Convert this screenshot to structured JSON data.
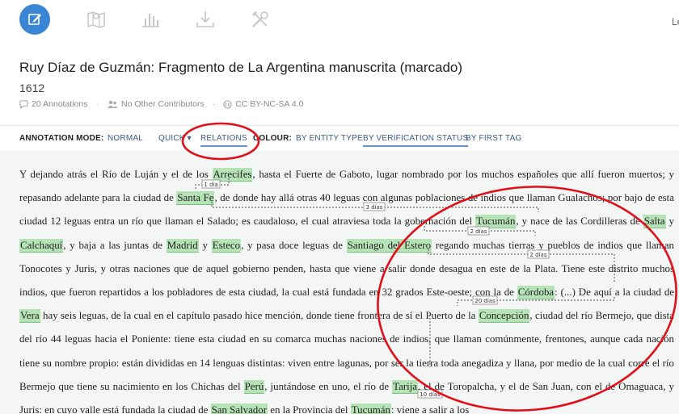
{
  "header": {
    "title": "Ruy Díaz de Guzmán: Fragmento de La Argentina manuscrita (marcado)",
    "year": "1612",
    "annotations": "20 Annotations",
    "contributors": "No Other Contributors",
    "license": "CC BY-NC-SA 4.0",
    "edge_text": "Le"
  },
  "toolbar": {
    "icons": [
      "edit-icon",
      "map-icon",
      "bar-chart-icon",
      "download-icon",
      "tools-icon"
    ],
    "accent": "#3a86d4"
  },
  "annotation_bar": {
    "mode_label": "ANNOTATION MODE:",
    "normal": "NORMAL",
    "quick": "QUICK",
    "relations": "RELATIONS",
    "colour_label": "COLOUR:",
    "by_entity_type": "BY ENTITY TYPE",
    "by_verification_status": "BY VERIFICATION STATUS",
    "by_first_tag": "BY FIRST TAG"
  },
  "relation_labels": [
    "1 día",
    "3 días",
    "2 días",
    "2 días",
    "20 días",
    "10 días"
  ],
  "colors": {
    "entity_highlight": "#b6e3b6",
    "markup_circle": "#e0101a",
    "link": "#3b5b8c"
  },
  "text": [
    {
      "t": "Y dejando atrás el Río de Luján y el de los "
    },
    {
      "e": "Arrecifes"
    },
    {
      "t": ", hasta el Fuerte de Gaboto, lugar nombrado por los muchos españoles que allí fueron muertos; y repasando adelante para la ciudad de "
    },
    {
      "e": "Santa Fe"
    },
    {
      "t": ", de donde hay allá otras 40 leguas con algunas poblaciones de indios que llaman Gualachos; por bajo de esta ciudad 12 leguas entra un río que llaman el Salado; es caudaloso, el cual atraviesa toda la gobernación del "
    },
    {
      "e": "Tucumán"
    },
    {
      "t": ", y nace de las Cordilleras de "
    },
    {
      "e": "Salta"
    },
    {
      "t": " y "
    },
    {
      "e": "Calchaquí"
    },
    {
      "t": ", y baja a las juntas de "
    },
    {
      "e": "Madrid"
    },
    {
      "t": " y "
    },
    {
      "e": "Esteco"
    },
    {
      "t": ", y pasa doce leguas de "
    },
    {
      "e": "Santiago del Estero"
    },
    {
      "t": " regando muchas tierras y pueblos de indios que llaman Tonocotes y Juris, y otras naciones que de aquel gobierno penden, hasta que viene a salir donde desagua en este de la Plata. Tiene este distrito muchos indios, que fueron repartidos a los pobladores de esta ciudad, la cual está fundada en 32 grados Este-oeste; con la de "
    },
    {
      "e": "Córdoba"
    },
    {
      "t": ": (...) De aquí a la ciudad de "
    },
    {
      "e": "Vera"
    },
    {
      "t": " hay seis leguas, de la cual en el capítulo pasado hice mención, donde tiene frontera de sí el Puerto de la "
    },
    {
      "e": "Concepción"
    },
    {
      "t": ", ciudad del río Bermejo, que dista del río 44 leguas hacia el Poniente: tiene esta ciudad en su comarca muchas naciones de indios, que llaman comúnmente, frentones, aunque cada nación tiene su nombre propio: están divididas en 14 lenguas distintas: viven entre lagunas, por ser la tierra toda anegadiza y llana, por medio de la cual corre el río Bermejo que tiene su nacimiento en los Chichas del "
    },
    {
      "e": "Perú"
    },
    {
      "t": ", juntándose en uno, el río de "
    },
    {
      "e": "Tarija"
    },
    {
      "t": ", el de Toropalcha, y el de San Juan, con el de Omaguaca, y Juris: en cuyo valle está fundada la ciudad de "
    },
    {
      "e": "San Salvador"
    },
    {
      "t": " en la Provincia del "
    },
    {
      "e": "Tucumán"
    },
    {
      "t": ": viene a salir a los"
    }
  ]
}
